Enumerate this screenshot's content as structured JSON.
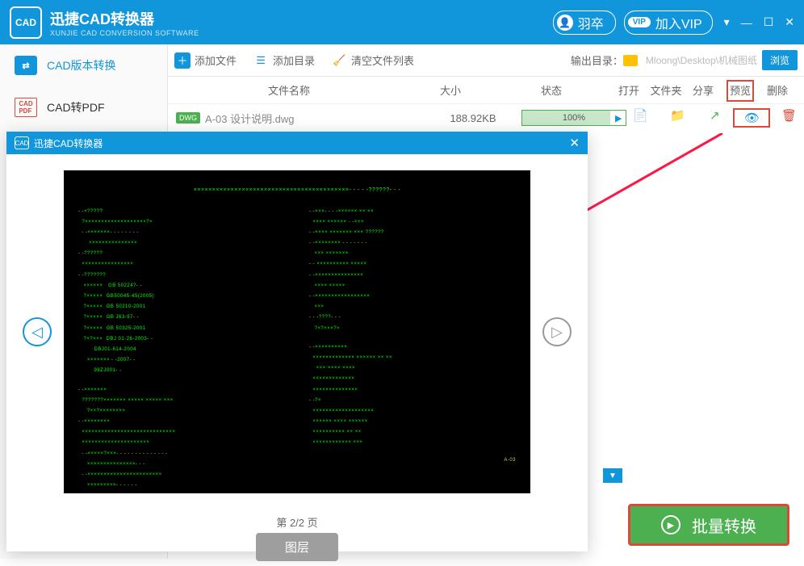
{
  "header": {
    "logo": "CAD",
    "title": "迅捷CAD转换器",
    "subtitle": "XUNJIE CAD CONVERSION SOFTWARE",
    "username": "羽卒",
    "vip_badge": "VIP",
    "vip_label": "加入VIP"
  },
  "sidebar": {
    "items": [
      {
        "icon": "CAD",
        "label": "CAD版本转换"
      },
      {
        "icon": "PDF",
        "label": "CAD转PDF"
      }
    ]
  },
  "toolbar": {
    "add_file": "添加文件",
    "add_dir": "添加目录",
    "clear": "清空文件列表",
    "output_label": "输出目录：",
    "output_path": "Mloong\\Desktop\\机械图纸",
    "browse": "浏览"
  },
  "table": {
    "headers": {
      "name": "文件名称",
      "size": "大小",
      "status": "状态",
      "open": "打开",
      "folder": "文件夹",
      "share": "分享",
      "preview": "预览",
      "delete": "删除"
    },
    "row": {
      "badge": "DWG",
      "name": "A-03 设计说明.dwg",
      "size": "188.92KB",
      "progress": "100%"
    }
  },
  "preview": {
    "title": "迅捷CAD转换器",
    "logo": "CAD",
    "page_info": "第 2/2 页",
    "layer_btn": "图层"
  },
  "batch_button": "批量转换"
}
